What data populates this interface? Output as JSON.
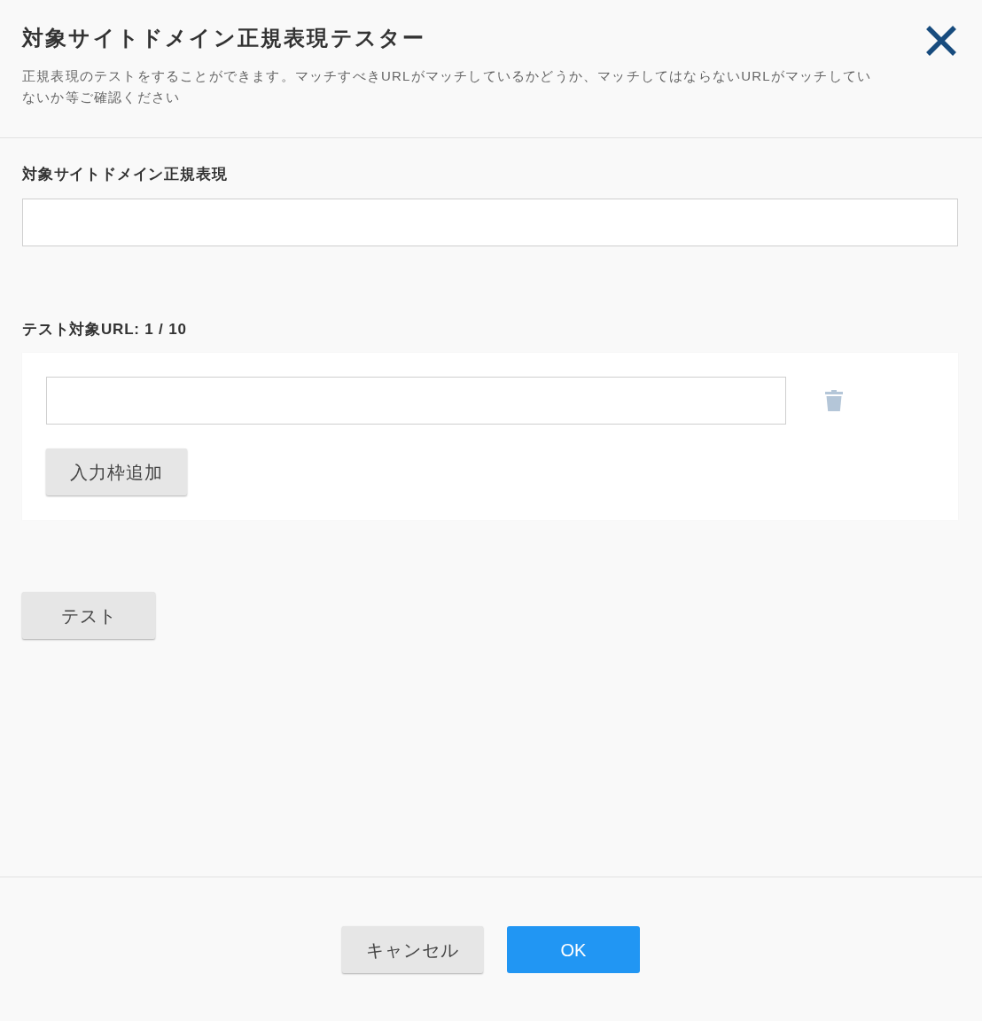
{
  "dialog": {
    "title": "対象サイトドメイン正規表現テスター",
    "description": "正規表現のテストをすることができます。マッチすべきURLがマッチしているかどうか、マッチしてはならないURLがマッチしていないか等ご確認ください"
  },
  "domain_regex": {
    "label": "対象サイトドメイン正規表現"
  },
  "test_urls": {
    "label": "テスト対象URL: 1 / 10",
    "rows": [
      {
        "delete_disabled": true
      }
    ],
    "add_button": "入力枠追加"
  },
  "test_button": "テスト",
  "footer": {
    "buttons": [
      {
        "label": "キャンセル",
        "kind": "secondary"
      },
      {
        "label": "OK",
        "kind": "primary"
      }
    ]
  }
}
